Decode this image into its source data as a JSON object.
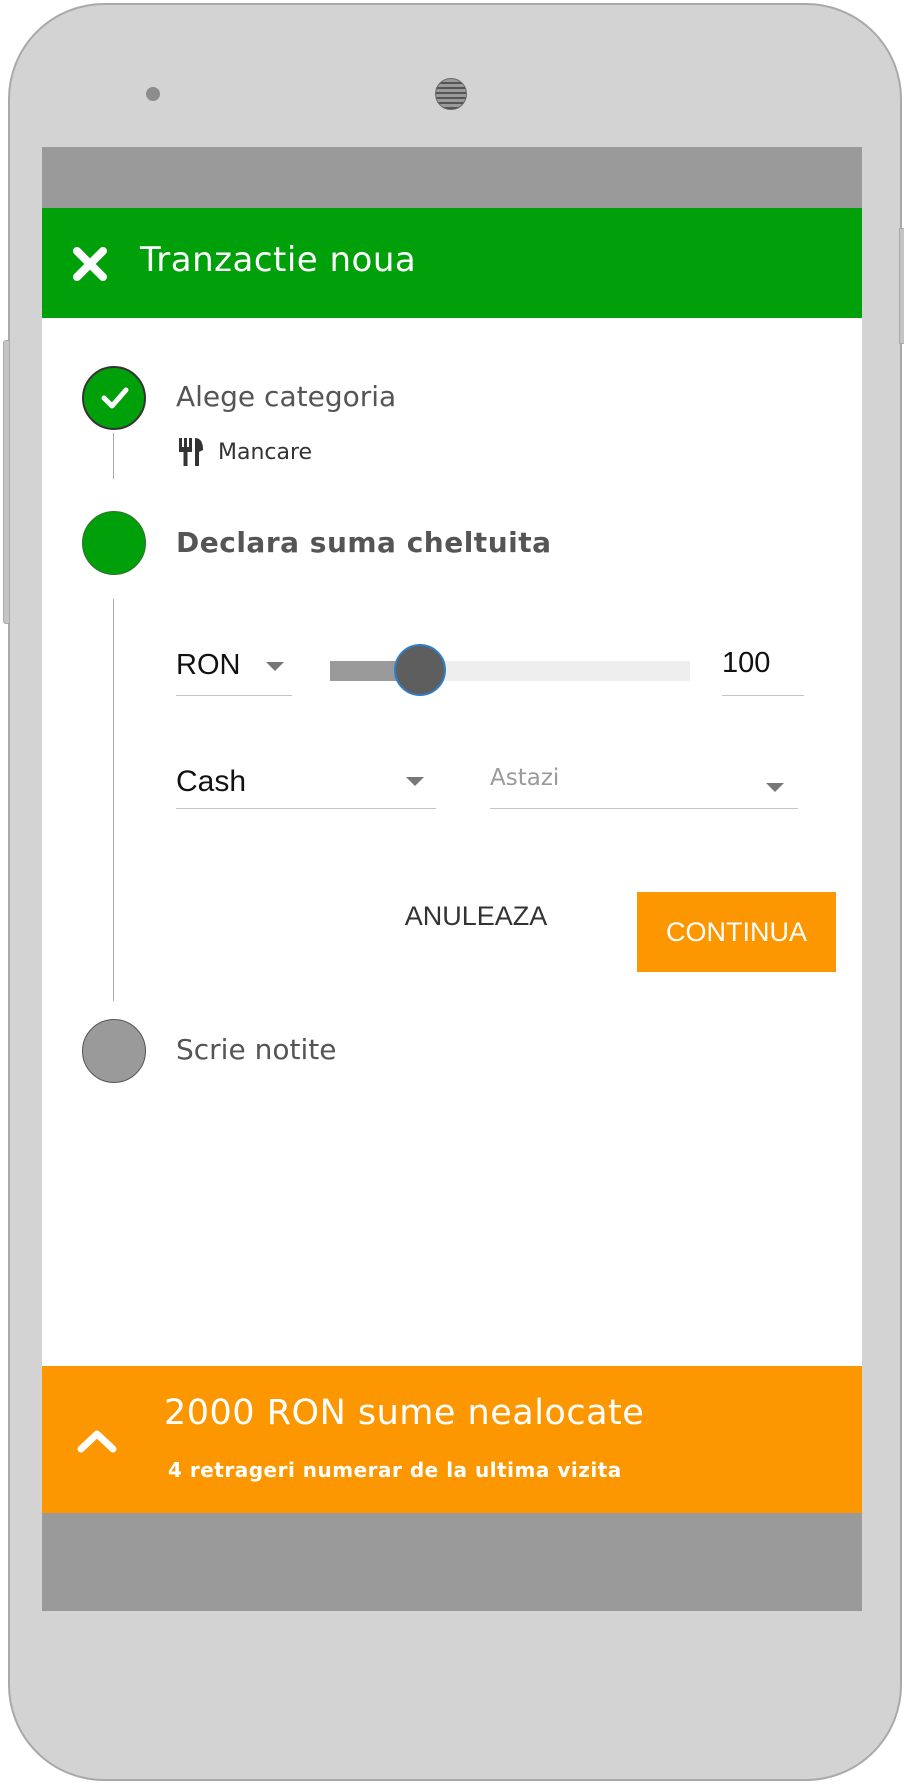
{
  "app_bar": {
    "title": "Tranzactie noua",
    "close_icon": "close-icon",
    "color": "#00a00a"
  },
  "steps": [
    {
      "label": "Alege categoria",
      "state": "done",
      "selection": {
        "icon": "fork-knife-icon",
        "label": "Mancare"
      }
    },
    {
      "label": "Declara suma cheltuita",
      "state": "active"
    },
    {
      "label": "Scrie notite",
      "state": "pending"
    }
  ],
  "amount_form": {
    "currency": "RON",
    "slider_fraction": 0.25,
    "amount": "100",
    "payment_method": "Cash",
    "date_placeholder": "Astazi"
  },
  "actions": {
    "cancel_label": "ANULEAZA",
    "continue_label": "CONTINUA"
  },
  "banner": {
    "title": "2000 RON sume nealocate",
    "subtitle": "4 retrageri numerar de la ultima vizita",
    "icon": "chevron-up-icon",
    "color": "#fd9701"
  }
}
